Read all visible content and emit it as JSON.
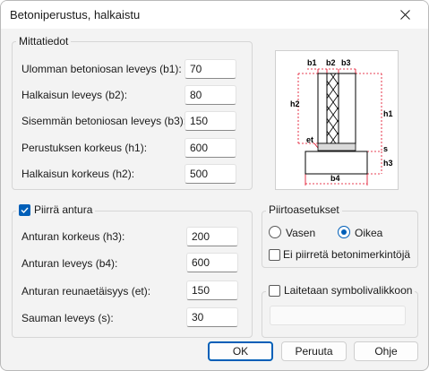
{
  "window": {
    "title": "Betoniperustus, halkaistu"
  },
  "dimensions": {
    "group_title": "Mittatiedot",
    "rows": [
      {
        "label": "Ulomman betoniosan leveys (b1):",
        "value": "70"
      },
      {
        "label": "Halkaisun leveys (b2):",
        "value": "80"
      },
      {
        "label": "Sisemmän betoniosan leveys (b3):",
        "value": "150"
      },
      {
        "label": "Perustuksen korkeus (h1):",
        "value": "600"
      },
      {
        "label": "Halkaisun korkeus (h2):",
        "value": "500"
      }
    ]
  },
  "footing": {
    "checkbox_label": "Piirrä antura",
    "checked": true,
    "rows": [
      {
        "label": "Anturan korkeus (h3):",
        "value": "200"
      },
      {
        "label": "Anturan leveys (b4):",
        "value": "600"
      },
      {
        "label": "Anturan reunaetäisyys (et):",
        "value": "150"
      },
      {
        "label": "Sauman leveys (s):",
        "value": "30"
      }
    ]
  },
  "diagram_labels": {
    "b1": "b1",
    "b2": "b2",
    "b3": "b3",
    "h1": "h1",
    "h2": "h2",
    "h3": "h3",
    "b4": "b4",
    "et": "et",
    "s": "s"
  },
  "draw_settings": {
    "group_title": "Piirtoasetukset",
    "options": [
      {
        "label": "Vasen",
        "selected": false
      },
      {
        "label": "Oikea",
        "selected": true
      }
    ],
    "no_markings_label": "Ei piirretä betonimerkintöjä",
    "no_markings_checked": false
  },
  "symbol_library": {
    "label": "Laitetaan symbolivalikkoon",
    "checked": false
  },
  "buttons": {
    "ok": "OK",
    "cancel": "Peruuta",
    "help": "Ohje"
  },
  "colors": {
    "accent": "#005fb8",
    "dimension": "#e0001b"
  }
}
